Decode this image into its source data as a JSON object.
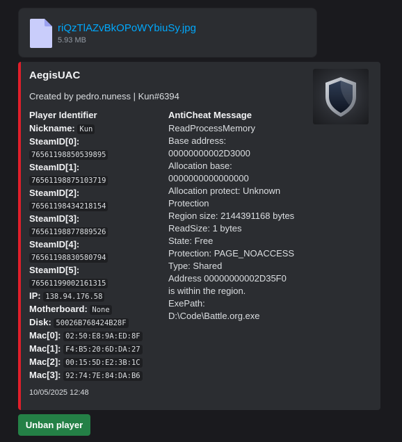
{
  "attachment": {
    "file_name": "riQzTlAZvBkOPoWYbiuSy.jpg",
    "file_size": "5.93 MB",
    "icon": "file-icon"
  },
  "embed": {
    "accent_color": "#e01e2a",
    "title": "AegisUAC",
    "description": "Created by pedro.nuness | Kun#6394",
    "thumbnail_icon": "shield-icon",
    "player_identifier": {
      "heading": "Player Identifier",
      "nickname_label": "Nickname:",
      "nickname": "Kun",
      "steam_ids": [
        {
          "label": "SteamID[0]:",
          "value": "76561198850539895"
        },
        {
          "label": "SteamID[1]:",
          "value": "76561198875103719"
        },
        {
          "label": "SteamID[2]:",
          "value": "76561198434218154"
        },
        {
          "label": "SteamID[3]:",
          "value": "76561198877889526"
        },
        {
          "label": "SteamID[4]:",
          "value": "76561198830580794"
        },
        {
          "label": "SteamID[5]:",
          "value": "76561199002161315"
        }
      ],
      "ip_label": "IP:",
      "ip": "138.94.176.58",
      "motherboard_label": "Motherboard:",
      "motherboard": "None",
      "disk_label": "Disk:",
      "disk": "50026B768424B28F",
      "macs": [
        {
          "label": "Mac[0]:",
          "value": "02:50:E8:9A:ED:8F"
        },
        {
          "label": "Mac[1]:",
          "value": "F4:B5:20:6D:DA:27"
        },
        {
          "label": "Mac[2]:",
          "value": "00:15:5D:E2:3B:1C"
        },
        {
          "label": "Mac[3]:",
          "value": "92:74:7E:84:DA:B6"
        }
      ]
    },
    "anticheat_message": {
      "heading": "AntiCheat Message",
      "lines": [
        "ReadProcessMemory",
        "Base address:",
        "00000000002D3000",
        "Allocation base:",
        "0000000000000000",
        "Allocation protect: Unknown",
        "Protection",
        "Region size: 2144391168 bytes",
        "ReadSize: 1 bytes",
        "State: Free",
        "Protection: PAGE_NOACCESS",
        "Type: Shared",
        "Address 00000000002D35F0",
        "is within the region.",
        "ExePath:",
        "D:\\Code\\Battle.org.exe"
      ]
    },
    "timestamp": "10/05/2025 12:48"
  },
  "actions": {
    "unban_label": "Unban player",
    "unban_color": "#248046"
  }
}
